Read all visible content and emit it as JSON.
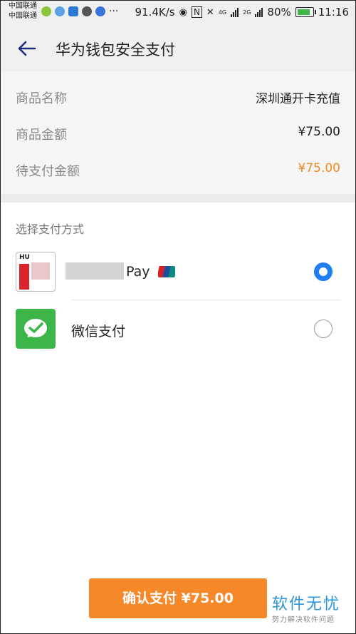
{
  "status_bar": {
    "carrier_1": "中国联通",
    "carrier_2": "中国联通",
    "net_speed": "91.4K/s",
    "network_1": "4G",
    "network_2": "2G",
    "battery": "80%",
    "time": "11:16",
    "overflow": "···"
  },
  "header": {
    "title": "华为钱包安全支付"
  },
  "order": {
    "rows": [
      {
        "label": "商品名称",
        "value": "深圳通开卡充值"
      },
      {
        "label": "商品金额",
        "value": "¥75.00"
      },
      {
        "label": "待支付金额",
        "value": "¥75.00"
      }
    ]
  },
  "payment": {
    "section_title": "选择支付方式",
    "methods": [
      {
        "label_visible": "Pay",
        "logo_text": "HU",
        "selected": true
      },
      {
        "label_visible": "微信支付",
        "selected": false
      }
    ]
  },
  "confirm_button": {
    "label": "确认支付 ¥75.00"
  },
  "watermark": {
    "main": "软件无忧",
    "sub": "努力解决软件问题"
  },
  "colors": {
    "accent_orange": "#f5892a",
    "radio_blue": "#1f7ff2",
    "wechat_green": "#3cb648"
  }
}
